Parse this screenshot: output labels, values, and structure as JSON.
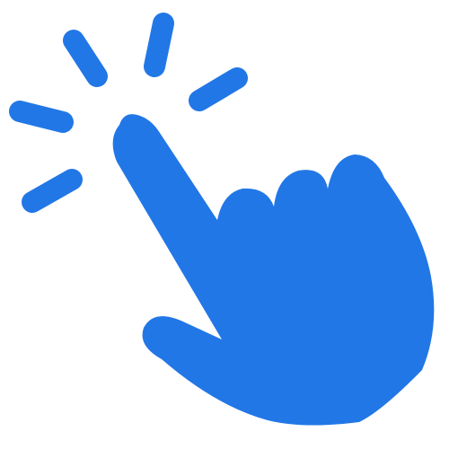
{
  "icon": {
    "name": "click-hand-icon",
    "description": "",
    "color": "#2277E6",
    "background": "#FFFFFF"
  }
}
